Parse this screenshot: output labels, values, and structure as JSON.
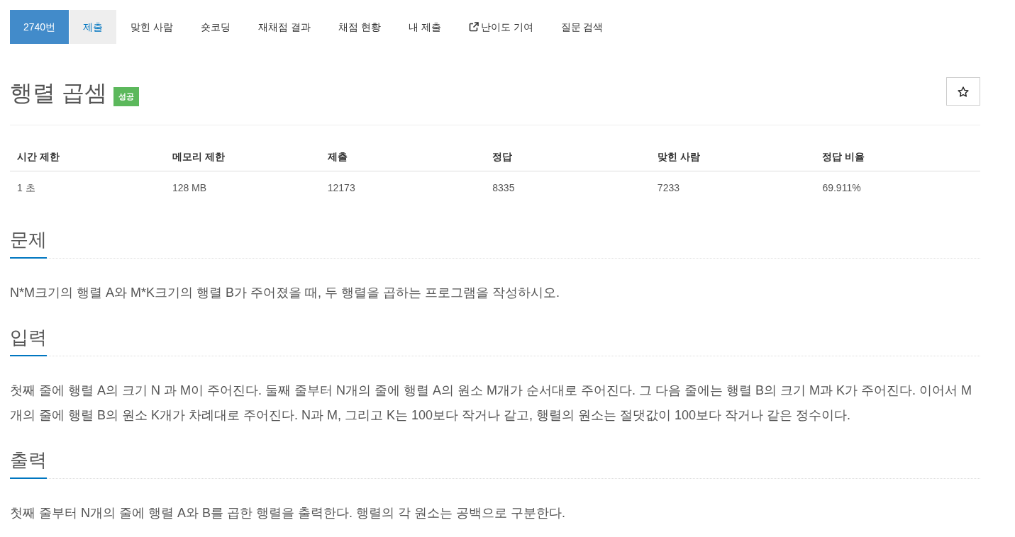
{
  "tabs": [
    {
      "label": "2740번",
      "selected": true,
      "hovered": false,
      "external": false
    },
    {
      "label": "제출",
      "selected": false,
      "hovered": true,
      "external": false
    },
    {
      "label": "맞힌 사람",
      "selected": false,
      "hovered": false,
      "external": false
    },
    {
      "label": "숏코딩",
      "selected": false,
      "hovered": false,
      "external": false
    },
    {
      "label": "재채점 결과",
      "selected": false,
      "hovered": false,
      "external": false
    },
    {
      "label": "채점 현황",
      "selected": false,
      "hovered": false,
      "external": false
    },
    {
      "label": "내 제출",
      "selected": false,
      "hovered": false,
      "external": false
    },
    {
      "label": "난이도 기여",
      "selected": false,
      "hovered": false,
      "external": true
    },
    {
      "label": "질문 검색",
      "selected": false,
      "hovered": false,
      "external": false
    }
  ],
  "problem": {
    "title": "행렬 곱셈",
    "badge": {
      "label": "성공",
      "kind": "success"
    },
    "starred": false
  },
  "limits": {
    "columns": [
      "시간 제한",
      "메모리 제한",
      "제출",
      "정답",
      "맞힌 사람",
      "정답 비율"
    ],
    "rows": [
      [
        "1 초",
        "128 MB",
        "12173",
        "8335",
        "7233",
        "69.911%"
      ]
    ]
  },
  "sections": [
    {
      "title": "문제",
      "body": "N*M크기의 행렬 A와 M*K크기의 행렬 B가 주어졌을 때, 두 행렬을 곱하는 프로그램을 작성하시오."
    },
    {
      "title": "입력",
      "body": "첫째 줄에 행렬 A의 크기 N 과 M이 주어진다. 둘째 줄부터 N개의 줄에 행렬 A의 원소 M개가 순서대로 주어진다. 그 다음 줄에는 행렬 B의 크기 M과 K가 주어진다. 이어서 M개의 줄에 행렬 B의 원소 K개가 차례대로 주어진다. N과 M, 그리고 K는 100보다 작거나 같고, 행렬의 원소는 절댓값이 100보다 작거나 같은 정수이다."
    },
    {
      "title": "출력",
      "body": "첫째 줄부터 N개의 줄에 행렬 A와 B를 곱한 행렬을 출력한다. 행렬의 각 원소는 공백으로 구분한다."
    }
  ]
}
